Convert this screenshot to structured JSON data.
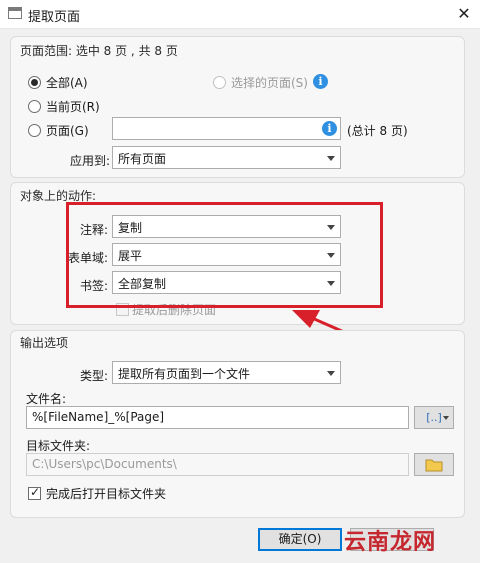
{
  "window": {
    "title": "提取页面",
    "close_glyph": "✕"
  },
  "page_range": {
    "group_title": "页面范围: 选中 8 页 , 共 8 页",
    "all_label": "全部(A)",
    "selected_label": "选择的页面(S)",
    "current_label": "当前页(R)",
    "pages_label": "页面(G)",
    "pages_value": "",
    "total_label": "(总计 8 页)",
    "apply_label": "应用到:",
    "apply_value": "所有页面",
    "info_glyph": "i"
  },
  "object_actions": {
    "group_title": "对象上的动作:",
    "annotation_label": "注释:",
    "annotation_value": "复制",
    "form_label": "表单域:",
    "form_value": "展平",
    "bookmark_label": "书签:",
    "bookmark_value": "全部复制",
    "delete_after_label": "提取后删除页面",
    "delete_after_checked": false
  },
  "output": {
    "group_title": "输出选项",
    "type_label": "类型:",
    "type_value": "提取所有页面到一个文件",
    "filename_label": "文件名:",
    "filename_value": "%[FileName]_%[Page]",
    "macro_glyph": "[..]",
    "folder_label": "目标文件夹:",
    "folder_value": "C:\\Users\\pc\\Documents\\",
    "open_after_label": "完成后打开目标文件夹",
    "open_after_checked": true
  },
  "buttons": {
    "ok_label": "确定(O)"
  },
  "watermark": {
    "text": "云南龙网"
  },
  "colors": {
    "highlight_red": "#d8202a",
    "info_blue": "#2f8fe0",
    "default_button_border": "#0078d7"
  },
  "icons": [
    "app-window-icon",
    "close-icon",
    "info-icon",
    "dropdown-arrow-icon",
    "macro-insert-icon",
    "folder-icon",
    "red-arrow-annotation"
  ]
}
